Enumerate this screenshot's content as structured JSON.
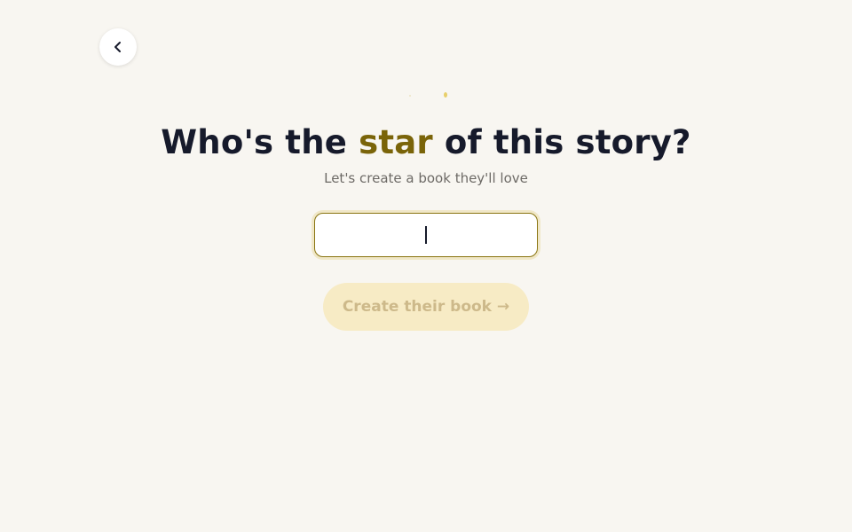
{
  "header": {
    "back_icon": "chevron-left-icon"
  },
  "headline": {
    "before": "Who's the ",
    "accent": "star",
    "after": " of this story?"
  },
  "subtitle": "Let's create a book they'll love",
  "name_input": {
    "value": "",
    "placeholder": ""
  },
  "create_button": {
    "label": "Create their book →"
  },
  "colors": {
    "background": "#f8f6f1",
    "accent": "#7a6409",
    "headline": "#161a2b",
    "button_disabled_bg": "#f7ebc5",
    "button_disabled_text": "#cdb98a"
  }
}
